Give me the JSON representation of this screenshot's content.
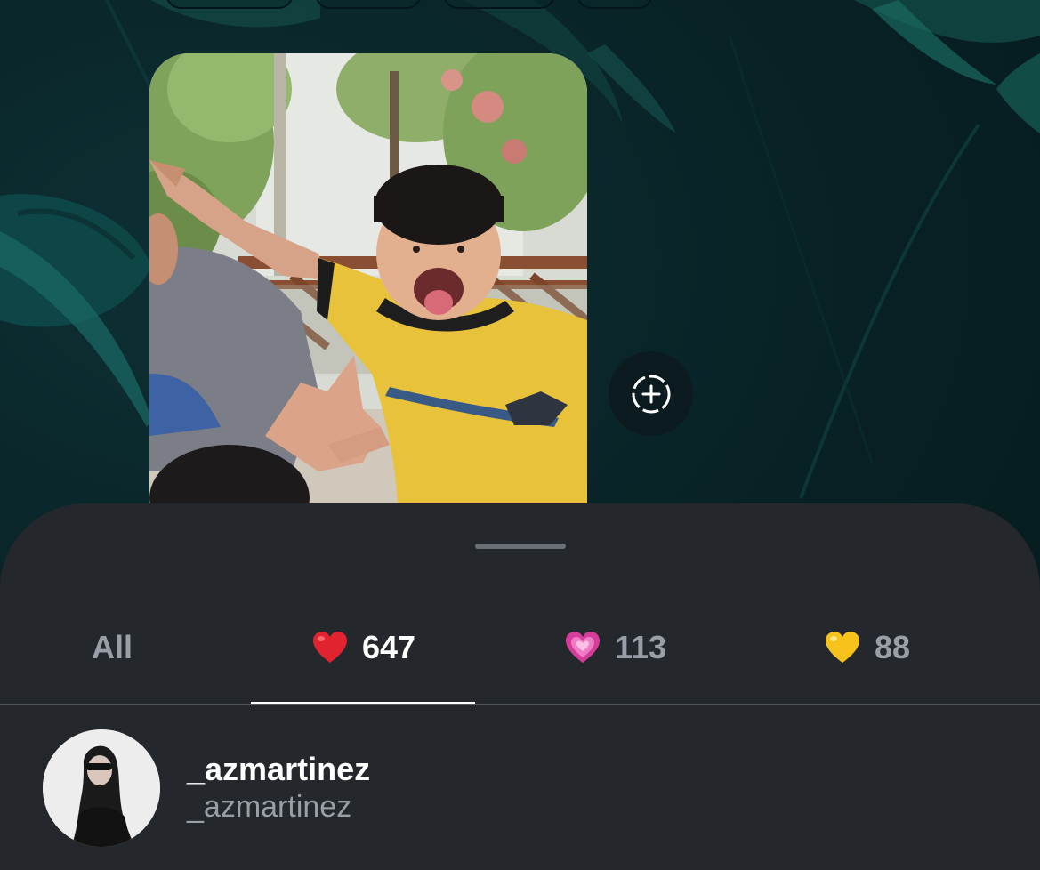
{
  "sheet": {
    "tabs": [
      {
        "label": "All",
        "icon": "",
        "active": false
      },
      {
        "label": "647",
        "icon": "red-heart-icon",
        "active": true
      },
      {
        "label": "113",
        "icon": "pink-heart-icon",
        "active": false
      },
      {
        "label": "88",
        "icon": "yellow-heart-icon",
        "active": false
      }
    ],
    "users": [
      {
        "username": "_azmartinez",
        "display_name": "_azmartinez"
      }
    ]
  },
  "colors": {
    "sheet_bg": "#24272c",
    "text_primary": "#ffffff",
    "text_secondary": "#9a9ea6",
    "background": "#082124"
  }
}
